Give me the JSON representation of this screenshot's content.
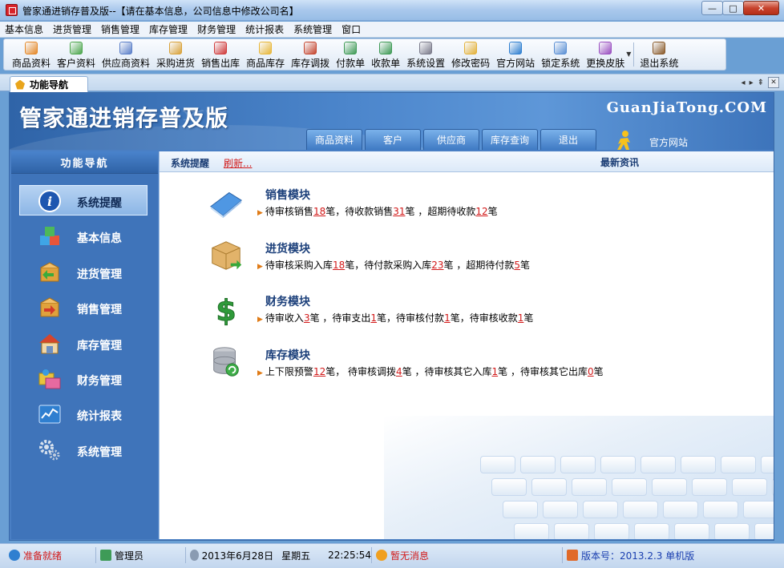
{
  "window": {
    "title": "管家通进销存普及版--【请在基本信息，公司信息中修改公司名】",
    "minimize": "—",
    "maximize": "□",
    "close": "✕"
  },
  "menu": [
    "基本信息",
    "进货管理",
    "销售管理",
    "库存管理",
    "财务管理",
    "统计报表",
    "系统管理",
    "窗口"
  ],
  "toolbar": [
    {
      "label": "商品资料",
      "color": "#e5892a"
    },
    {
      "label": "客户资料",
      "color": "#4ca64c"
    },
    {
      "label": "供应商资料",
      "color": "#5b7fc8"
    },
    {
      "label": "采购进货",
      "color": "#d9a23a"
    },
    {
      "label": "销售出库",
      "color": "#d03b3b"
    },
    {
      "label": "商品库存",
      "color": "#e8b73a"
    },
    {
      "label": "库存调拨",
      "color": "#c5462f"
    },
    {
      "label": "付款单",
      "color": "#3f9a56"
    },
    {
      "label": "收款单",
      "color": "#3f9a56"
    },
    {
      "label": "系统设置",
      "color": "#7a7a8a"
    },
    {
      "label": "修改密码",
      "color": "#e3b23c"
    },
    {
      "label": "官方网站",
      "color": "#2f7fd0"
    },
    {
      "label": "锁定系统",
      "color": "#5a8fd4"
    },
    {
      "label": "更换皮肤",
      "color": "#9a4fc0"
    },
    {
      "label": "退出系统",
      "color": "#8a5a2a"
    }
  ],
  "tabs": {
    "active": "功能导航",
    "prev": "◂",
    "next": "▸",
    "pin": "⇞",
    "close": "✕"
  },
  "banner": {
    "title": "管家通进销存普及版",
    "brand": "GuanJiaTong.COM",
    "tabs": [
      "商品资料",
      "客户",
      "供应商",
      "库存查询",
      "退出"
    ],
    "site_link": "官方网站"
  },
  "nav": {
    "header": "功能导航",
    "items": [
      {
        "label": "系统提醒",
        "icon": "info-icon",
        "active": true
      },
      {
        "label": "基本信息",
        "icon": "cubes-icon",
        "active": false
      },
      {
        "label": "进货管理",
        "icon": "box-in-icon",
        "active": false
      },
      {
        "label": "销售管理",
        "icon": "box-out-icon",
        "active": false
      },
      {
        "label": "库存管理",
        "icon": "warehouse-icon",
        "active": false
      },
      {
        "label": "财务管理",
        "icon": "finance-icon",
        "active": false
      },
      {
        "label": "统计报表",
        "icon": "chart-icon",
        "active": false
      },
      {
        "label": "系统管理",
        "icon": "gears-icon",
        "active": false
      }
    ]
  },
  "main": {
    "remind_label": "系统提醒",
    "refresh_link": "刷新...",
    "news_label": "最新资讯",
    "modules": [
      {
        "title": "销售模块",
        "parts": [
          {
            "t": "待审核销售"
          },
          {
            "n": "18"
          },
          {
            "t": "笔，待收款销售"
          },
          {
            "n": "31"
          },
          {
            "t": "笔 ，超期待收款"
          },
          {
            "n": "12"
          },
          {
            "t": "笔"
          }
        ]
      },
      {
        "title": "进货模块",
        "parts": [
          {
            "t": "待审核采购入库"
          },
          {
            "n": "18"
          },
          {
            "t": "笔，待付款采购入库"
          },
          {
            "n": "23"
          },
          {
            "t": "笔 ，超期待付款"
          },
          {
            "n": "5"
          },
          {
            "t": "笔"
          }
        ]
      },
      {
        "title": "财务模块",
        "parts": [
          {
            "t": "待审收入"
          },
          {
            "n": "3"
          },
          {
            "t": "笔 ，待审支出"
          },
          {
            "n": "1"
          },
          {
            "t": "笔，待审核付款"
          },
          {
            "n": "1"
          },
          {
            "t": "笔，待审核收款"
          },
          {
            "n": "1"
          },
          {
            "t": "笔"
          }
        ]
      },
      {
        "title": "库存模块",
        "parts": [
          {
            "t": "上下限预警"
          },
          {
            "n": "12"
          },
          {
            "t": "笔，  待审核调拨"
          },
          {
            "n": "4"
          },
          {
            "t": "笔 ，待审核其它入库"
          },
          {
            "n": "1"
          },
          {
            "t": "笔 ，待审核其它出库"
          },
          {
            "n": "0"
          },
          {
            "t": "笔"
          }
        ]
      }
    ]
  },
  "status": {
    "ready": "准备就绪",
    "user": "管理员",
    "date": "2013年6月28日",
    "weekday": "星期五",
    "time": "22:25:54",
    "message": "暂无消息",
    "version": "版本号：2013.2.3 单机版"
  },
  "colors": {
    "accent_red": "#d21a1a",
    "nav_bg": "#3f74ba",
    "banner_blue": "#4c86cc",
    "version_blue": "#1a3fb0"
  }
}
